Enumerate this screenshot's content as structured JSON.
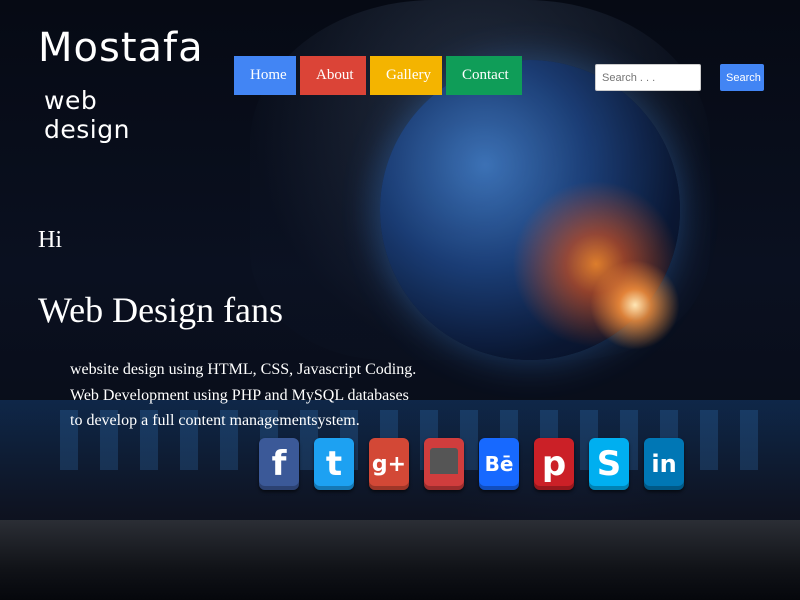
{
  "logo": {
    "mark_text": "Mostafa",
    "sub_text": "web design"
  },
  "nav": {
    "items": [
      {
        "label": "Home",
        "color": "#4285f4"
      },
      {
        "label": "About",
        "color": "#db4437"
      },
      {
        "label": "Gallery",
        "color": "#f4b400"
      },
      {
        "label": "Contact",
        "color": "#0f9d58"
      }
    ]
  },
  "search": {
    "placeholder": "Search . . .",
    "button_label": "Search"
  },
  "hero": {
    "greeting": "Hi",
    "title": "Web Design fans",
    "description_lines": [
      "website design using HTML, CSS, Javascript Coding.",
      "Web Development using PHP and MySQL databases",
      "to develop a full content managementsystem."
    ]
  },
  "social": {
    "icons": [
      {
        "name": "facebook-icon",
        "glyph": "f",
        "color": "#3b5998"
      },
      {
        "name": "twitter-icon",
        "glyph": "t",
        "color": "#1da1f2"
      },
      {
        "name": "google-plus-icon",
        "glyph": "g+",
        "color": "#d34836"
      },
      {
        "name": "flickr-icon",
        "glyph": "",
        "color": "#d03d3d"
      },
      {
        "name": "behance-icon",
        "glyph": "Bē",
        "color": "#1769ff"
      },
      {
        "name": "pinterest-icon",
        "glyph": "p",
        "color": "#cb2027"
      },
      {
        "name": "skype-icon",
        "glyph": "S",
        "color": "#00aff0"
      },
      {
        "name": "linkedin-icon",
        "glyph": "in",
        "color": "#0077b5"
      }
    ]
  }
}
